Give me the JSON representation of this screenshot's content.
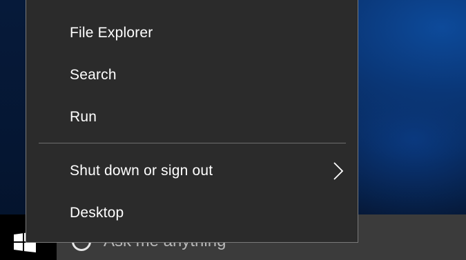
{
  "context_menu": {
    "items": [
      {
        "label": "File Explorer"
      },
      {
        "label": "Search"
      },
      {
        "label": "Run"
      },
      {
        "label": "Shut down or sign out",
        "icon": "chevron-right-icon"
      },
      {
        "label": "Desktop"
      }
    ]
  },
  "taskbar": {
    "start_icon": "windows-logo-icon",
    "search": {
      "icon": "cortana-circle-icon",
      "placeholder": "Ask me anything"
    }
  },
  "colors": {
    "menu_background": "#2b2b2b",
    "menu_text": "#ffffff",
    "divider": "#6e6e6e",
    "taskbar": "#1c1c1c",
    "search_box": "#3b3b3b",
    "desktop_accent": "#0d4a9a"
  }
}
